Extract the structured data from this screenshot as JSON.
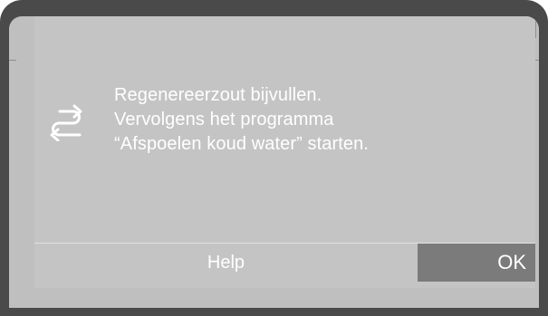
{
  "dialog": {
    "icon": "swap-arrows-icon",
    "message_lines": [
      "Regenereerzout bijvullen.",
      "Vervolgens het programma",
      "“Afspoelen koud water” starten."
    ]
  },
  "softkeys": {
    "help_label": "Help",
    "ok_label": "OK"
  },
  "colors": {
    "frame": "#4a4a4a",
    "screen_background": "#c4c4c4",
    "text": "#ffffff",
    "ok_highlight": "#7b7b7b"
  }
}
